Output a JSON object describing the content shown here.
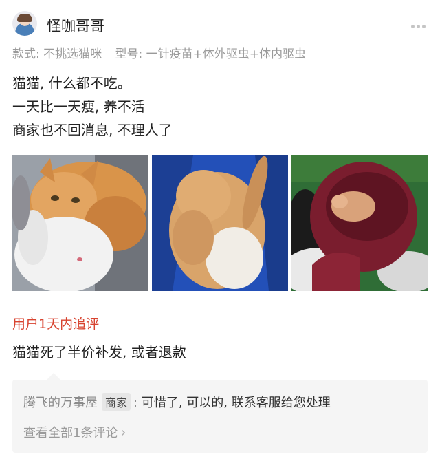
{
  "user": {
    "name": "怪咖哥哥"
  },
  "spec": {
    "style": "款式: 不挑选猫咪",
    "model": "型号: 一针疫苗+体外驱虫+体内驱虫"
  },
  "review": {
    "lines": [
      "猫猫, 什么都不吃。",
      "一天比一天瘦, 养不活",
      "商家也不回消息, 不理人了"
    ]
  },
  "photos": [
    {
      "icon": "kitten-with-rabbit-photo"
    },
    {
      "icon": "curled-kitten-on-blue-cloth-photo"
    },
    {
      "icon": "kitten-in-bag-photo"
    }
  ],
  "followup": {
    "title": "用户1天内追评",
    "text": "猫猫死了半价补发, 或者退款"
  },
  "reply": {
    "shop": "腾飞的万事屋",
    "tag": "商家",
    "colon": ":",
    "text": "可惜了, 可以的, 联系客服给您处理",
    "view_all": "查看全部1条评论"
  },
  "colors": {
    "accent": "#d8432f",
    "secondary_text": "#9a9a9a",
    "reply_bg": "#f5f5f5"
  }
}
